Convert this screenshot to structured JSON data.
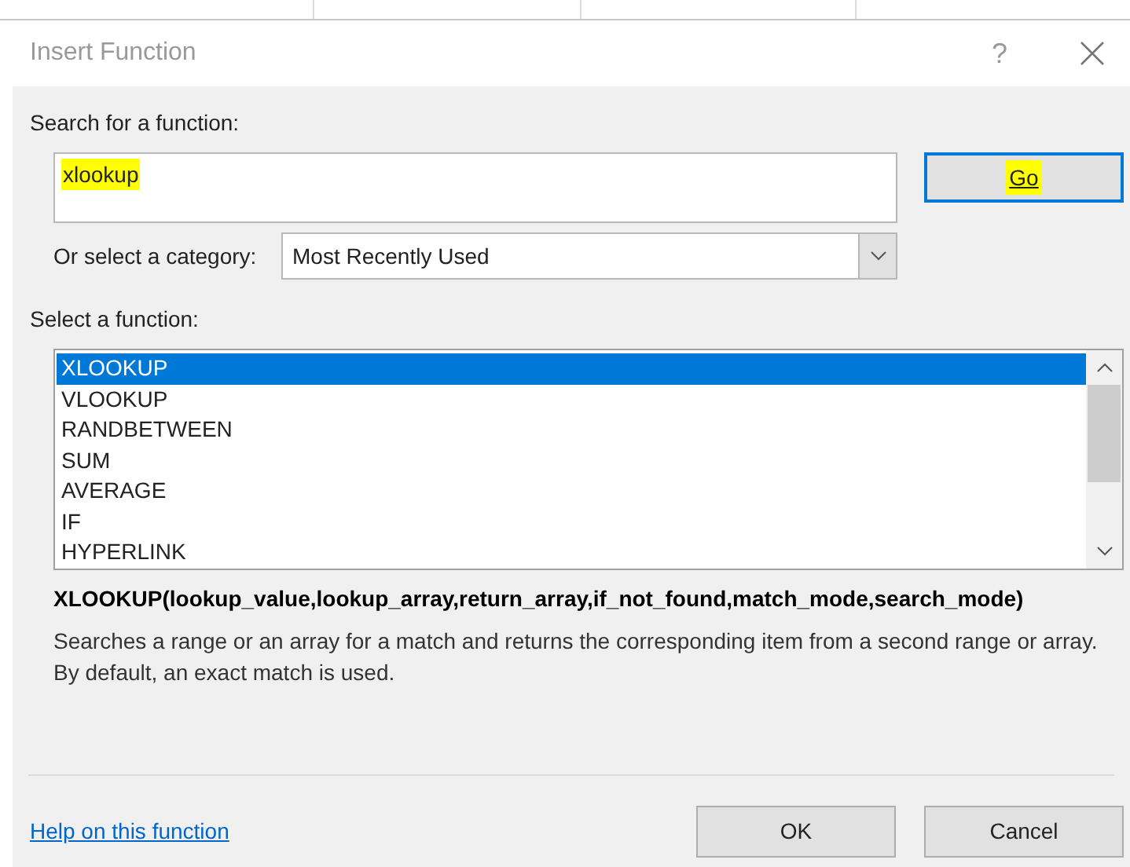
{
  "window": {
    "title": "Insert Function",
    "help": "?"
  },
  "search": {
    "label": "Search for a function:",
    "value": "xlookup",
    "highlighted": true
  },
  "go_button": {
    "label": "Go",
    "highlighted": true
  },
  "category": {
    "label": "Or select a category:",
    "value": "Most Recently Used"
  },
  "function_list": {
    "label": "Select a function:",
    "items": [
      {
        "name": "XLOOKUP",
        "selected": true
      },
      {
        "name": "VLOOKUP",
        "selected": false
      },
      {
        "name": "RANDBETWEEN",
        "selected": false
      },
      {
        "name": "SUM",
        "selected": false
      },
      {
        "name": "AVERAGE",
        "selected": false
      },
      {
        "name": "IF",
        "selected": false
      },
      {
        "name": "HYPERLINK",
        "selected": false
      }
    ]
  },
  "syntax": "XLOOKUP(lookup_value,lookup_array,return_array,if_not_found,match_mode,search_mode)",
  "description": "Searches a range or an array for a match and returns the corresponding item from a second range or array. By default, an exact match is used.",
  "help_link": "Help on this function",
  "buttons": [
    "OK",
    "Cancel"
  ]
}
